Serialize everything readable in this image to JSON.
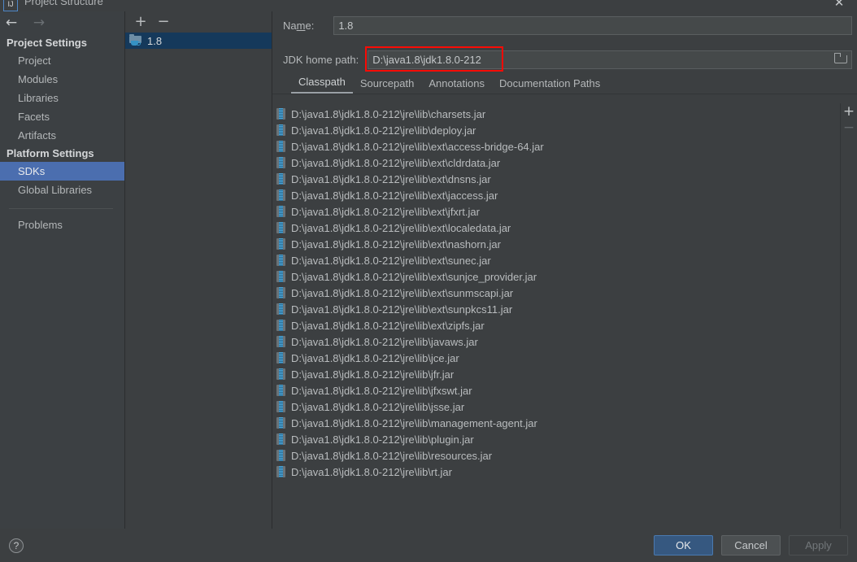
{
  "window": {
    "title": "Project Structure",
    "app_icon": "intellij-idea-icon",
    "close_label": "✕"
  },
  "sidebar": {
    "nav": {
      "back": "←",
      "forward": "→"
    },
    "groups": [
      {
        "title": "Project Settings",
        "items": [
          {
            "label": "Project",
            "selected": false
          },
          {
            "label": "Modules",
            "selected": false
          },
          {
            "label": "Libraries",
            "selected": false
          },
          {
            "label": "Facets",
            "selected": false
          },
          {
            "label": "Artifacts",
            "selected": false
          }
        ]
      },
      {
        "title": "Platform Settings",
        "items": [
          {
            "label": "SDKs",
            "selected": true
          },
          {
            "label": "Global Libraries",
            "selected": false
          }
        ]
      }
    ],
    "extra_items": [
      {
        "label": "Problems",
        "selected": false
      }
    ]
  },
  "sdk_pane": {
    "toolbar": {
      "add": "+",
      "remove": "−"
    },
    "items": [
      {
        "label": "1.8",
        "selected": true,
        "icon": "java-sdk-folder-icon"
      }
    ]
  },
  "detail": {
    "name_label": "Name:",
    "name_value": "1.8",
    "jdk_path_label": "JDK home path:",
    "jdk_path_value": "D:\\java1.8\\jdk1.8.0-212",
    "browse_icon": "folder-browse-icon",
    "highlight_color": "#fa0b06",
    "tabs": [
      {
        "label": "Classpath",
        "active": true
      },
      {
        "label": "Sourcepath",
        "active": false
      },
      {
        "label": "Annotations",
        "active": false
      },
      {
        "label": "Documentation Paths",
        "active": false
      }
    ],
    "rail": {
      "add": "+",
      "remove": "−"
    },
    "classpath_entries": [
      "D:\\java1.8\\jdk1.8.0-212\\jre\\lib\\charsets.jar",
      "D:\\java1.8\\jdk1.8.0-212\\jre\\lib\\deploy.jar",
      "D:\\java1.8\\jdk1.8.0-212\\jre\\lib\\ext\\access-bridge-64.jar",
      "D:\\java1.8\\jdk1.8.0-212\\jre\\lib\\ext\\cldrdata.jar",
      "D:\\java1.8\\jdk1.8.0-212\\jre\\lib\\ext\\dnsns.jar",
      "D:\\java1.8\\jdk1.8.0-212\\jre\\lib\\ext\\jaccess.jar",
      "D:\\java1.8\\jdk1.8.0-212\\jre\\lib\\ext\\jfxrt.jar",
      "D:\\java1.8\\jdk1.8.0-212\\jre\\lib\\ext\\localedata.jar",
      "D:\\java1.8\\jdk1.8.0-212\\jre\\lib\\ext\\nashorn.jar",
      "D:\\java1.8\\jdk1.8.0-212\\jre\\lib\\ext\\sunec.jar",
      "D:\\java1.8\\jdk1.8.0-212\\jre\\lib\\ext\\sunjce_provider.jar",
      "D:\\java1.8\\jdk1.8.0-212\\jre\\lib\\ext\\sunmscapi.jar",
      "D:\\java1.8\\jdk1.8.0-212\\jre\\lib\\ext\\sunpkcs11.jar",
      "D:\\java1.8\\jdk1.8.0-212\\jre\\lib\\ext\\zipfs.jar",
      "D:\\java1.8\\jdk1.8.0-212\\jre\\lib\\javaws.jar",
      "D:\\java1.8\\jdk1.8.0-212\\jre\\lib\\jce.jar",
      "D:\\java1.8\\jdk1.8.0-212\\jre\\lib\\jfr.jar",
      "D:\\java1.8\\jdk1.8.0-212\\jre\\lib\\jfxswt.jar",
      "D:\\java1.8\\jdk1.8.0-212\\jre\\lib\\jsse.jar",
      "D:\\java1.8\\jdk1.8.0-212\\jre\\lib\\management-agent.jar",
      "D:\\java1.8\\jdk1.8.0-212\\jre\\lib\\plugin.jar",
      "D:\\java1.8\\jdk1.8.0-212\\jre\\lib\\resources.jar",
      "D:\\java1.8\\jdk1.8.0-212\\jre\\lib\\rt.jar"
    ]
  },
  "footer": {
    "help_label": "?",
    "buttons": [
      {
        "label": "OK",
        "style": "primary"
      },
      {
        "label": "Cancel",
        "style": "normal"
      },
      {
        "label": "Apply",
        "style": "disabled"
      }
    ]
  }
}
